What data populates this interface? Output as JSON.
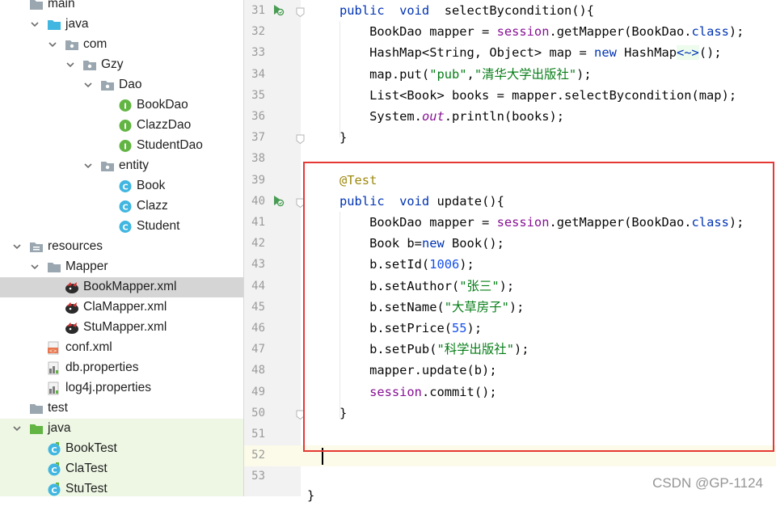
{
  "tree": {
    "items": [
      {
        "label": "main",
        "kind": "folder-gray"
      },
      {
        "label": "java",
        "kind": "folder-blue"
      },
      {
        "label": "com",
        "kind": "package"
      },
      {
        "label": "Gzy",
        "kind": "package"
      },
      {
        "label": "Dao",
        "kind": "package"
      },
      {
        "label": "BookDao",
        "kind": "interface"
      },
      {
        "label": "ClazzDao",
        "kind": "interface"
      },
      {
        "label": "StudentDao",
        "kind": "interface"
      },
      {
        "label": "entity",
        "kind": "package"
      },
      {
        "label": "Book",
        "kind": "class"
      },
      {
        "label": "Clazz",
        "kind": "class"
      },
      {
        "label": "Student",
        "kind": "class"
      },
      {
        "label": "resources",
        "kind": "resources"
      },
      {
        "label": "Mapper",
        "kind": "folder-gray"
      },
      {
        "label": "BookMapper.xml",
        "kind": "mybatis"
      },
      {
        "label": "ClaMapper.xml",
        "kind": "mybatis"
      },
      {
        "label": "StuMapper.xml",
        "kind": "mybatis"
      },
      {
        "label": "conf.xml",
        "kind": "xml"
      },
      {
        "label": "db.properties",
        "kind": "properties"
      },
      {
        "label": "log4j.properties",
        "kind": "properties"
      },
      {
        "label": "test",
        "kind": "folder-gray"
      },
      {
        "label": "java",
        "kind": "folder-green"
      },
      {
        "label": "BookTest",
        "kind": "testclass"
      },
      {
        "label": "ClaTest",
        "kind": "testclass"
      },
      {
        "label": "StuTest",
        "kind": "testclass"
      }
    ],
    "selected": "BookMapper.xml"
  },
  "editor": {
    "line_numbers": [
      "31",
      "32",
      "33",
      "34",
      "35",
      "36",
      "37",
      "38",
      "39",
      "40",
      "41",
      "42",
      "43",
      "44",
      "45",
      "46",
      "47",
      "48",
      "49",
      "50",
      "51",
      "52",
      "53"
    ],
    "lines": [
      [
        [
          "kw",
          "public  void  "
        ],
        [
          "",
          "selectBycondition(){"
        ]
      ],
      [
        [
          "",
          "    BookDao mapper = "
        ],
        [
          "fld",
          "session"
        ],
        [
          "",
          ".getMapper(BookDao."
        ],
        [
          "kw",
          "class"
        ],
        [
          "",
          ");"
        ]
      ],
      [
        [
          "",
          "    HashMap<String, Object> map = "
        ],
        [
          "kw",
          "new "
        ],
        [
          "",
          "HashMap"
        ],
        [
          "gen",
          "<~>"
        ],
        [
          "",
          "();"
        ]
      ],
      [
        [
          "",
          "    map.put("
        ],
        [
          "str",
          "\"pub\""
        ],
        [
          "",
          ","
        ],
        [
          "str",
          "\"清华大学出版社\""
        ],
        [
          "",
          ");"
        ]
      ],
      [
        [
          "",
          "    List<Book> books = mapper.selectBycondition(map);"
        ]
      ],
      [
        [
          "",
          "    System."
        ],
        [
          "ital",
          "out"
        ],
        [
          "",
          ".println(books);"
        ]
      ],
      [
        [
          "",
          "}"
        ]
      ],
      [
        [
          "",
          ""
        ]
      ],
      [
        [
          "ann",
          "@Test"
        ]
      ],
      [
        [
          "kw",
          "public  void "
        ],
        [
          "",
          "update(){"
        ]
      ],
      [
        [
          "",
          "    BookDao mapper = "
        ],
        [
          "fld",
          "session"
        ],
        [
          "",
          ".getMapper(BookDao."
        ],
        [
          "kw",
          "class"
        ],
        [
          "",
          ");"
        ]
      ],
      [
        [
          "",
          "    Book b="
        ],
        [
          "kw",
          "new "
        ],
        [
          "",
          "Book();"
        ]
      ],
      [
        [
          "",
          "    b.setId("
        ],
        [
          "num",
          "1006"
        ],
        [
          "",
          ");"
        ]
      ],
      [
        [
          "",
          "    b.setAuthor("
        ],
        [
          "str",
          "\"张三\""
        ],
        [
          "",
          ");"
        ]
      ],
      [
        [
          "",
          "    b.setName("
        ],
        [
          "str",
          "\"大草房子\""
        ],
        [
          "",
          ");"
        ]
      ],
      [
        [
          "",
          "    b.setPrice("
        ],
        [
          "num",
          "55"
        ],
        [
          "",
          ");"
        ]
      ],
      [
        [
          "",
          "    b.setPub("
        ],
        [
          "str",
          "\"科学出版社\""
        ],
        [
          "",
          ");"
        ]
      ],
      [
        [
          "",
          "    mapper.update(b);"
        ]
      ],
      [
        [
          "",
          "    "
        ],
        [
          "fld",
          "session"
        ],
        [
          "",
          ".commit();"
        ]
      ],
      [
        [
          "",
          "}"
        ]
      ],
      [
        [
          "",
          ""
        ]
      ],
      [
        [
          "",
          ""
        ]
      ],
      [
        [
          "",
          ""
        ]
      ]
    ],
    "run_gutter_lines": [
      "31",
      "40"
    ],
    "fold_lines": [
      "31",
      "37",
      "40",
      "50"
    ],
    "trailing_brace": "}"
  },
  "watermark": "CSDN @GP-1124",
  "colors": {
    "keyword": "#0033b3",
    "string": "#067d17",
    "number": "#1750eb",
    "annotation": "#9e880d",
    "field": "#871094",
    "highlight_box": "#e53935",
    "selection": "#d5d5d5"
  }
}
